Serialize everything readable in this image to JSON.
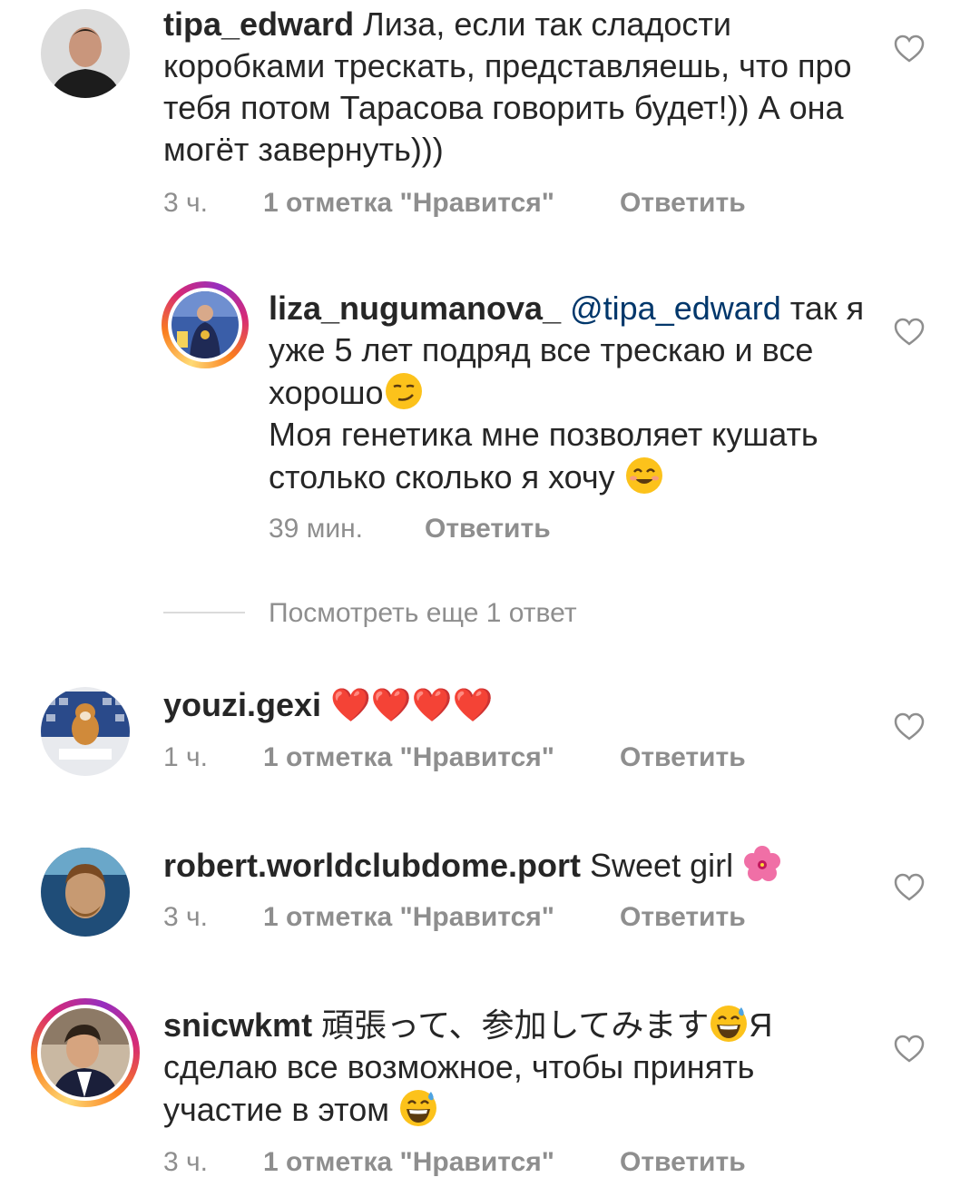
{
  "comments": [
    {
      "username": "tipa_edward",
      "text": " Лиза, если так сладости коробками трескать, представляешь, что про тебя потом Тарасова говорить будет!)) А она могёт завернуть)))",
      "time": "3 ч.",
      "likes": "1 отметка \"Нравится\"",
      "reply": "Ответить",
      "avatar": "man-portrait"
    },
    {
      "username": "liza_nugumanova_",
      "mention": "@tipa_edward",
      "text_a": " так я уже 5 лет подряд все трескаю и все хорошо",
      "text_b": "Моя генетика мне позволяет кушать столько сколько я хочу ",
      "time": "39 мин.",
      "reply": "Ответить",
      "avatar": "skater-with-medal"
    },
    {
      "view_more": "Посмотреть еще 1 ответ"
    },
    {
      "username": "youzi.gexi",
      "text": " ❤️❤️❤️❤️",
      "time": "1 ч.",
      "likes": "1 отметка \"Нравится\"",
      "reply": "Ответить",
      "avatar": "plush-dog"
    },
    {
      "username": "robert.worldclubdome.port",
      "text": " Sweet girl ",
      "time": "3 ч.",
      "likes": "1 отметка \"Нравится\"",
      "reply": "Ответить",
      "avatar": "man-face"
    },
    {
      "username": "snicwkmt",
      "text_a": " 頑張って、参加してみます",
      "text_b": "Я сделаю все возможное, чтобы принять участие в этом ",
      "time": "3 ч.",
      "likes": "1 отметка \"Нравится\"",
      "reply": "Ответить",
      "avatar": "person-photo"
    }
  ],
  "icons": {
    "like": "heart-outline-icon",
    "smirk": "smirking-face-emoji",
    "smile": "smiling-face-emoji",
    "hibiscus": "hibiscus-emoji",
    "sweat": "grinning-sweat-emoji"
  },
  "colors": {
    "text": "#262626",
    "meta": "#8e8e8e",
    "mention": "#00376b",
    "heart": "#ed2a3a"
  }
}
